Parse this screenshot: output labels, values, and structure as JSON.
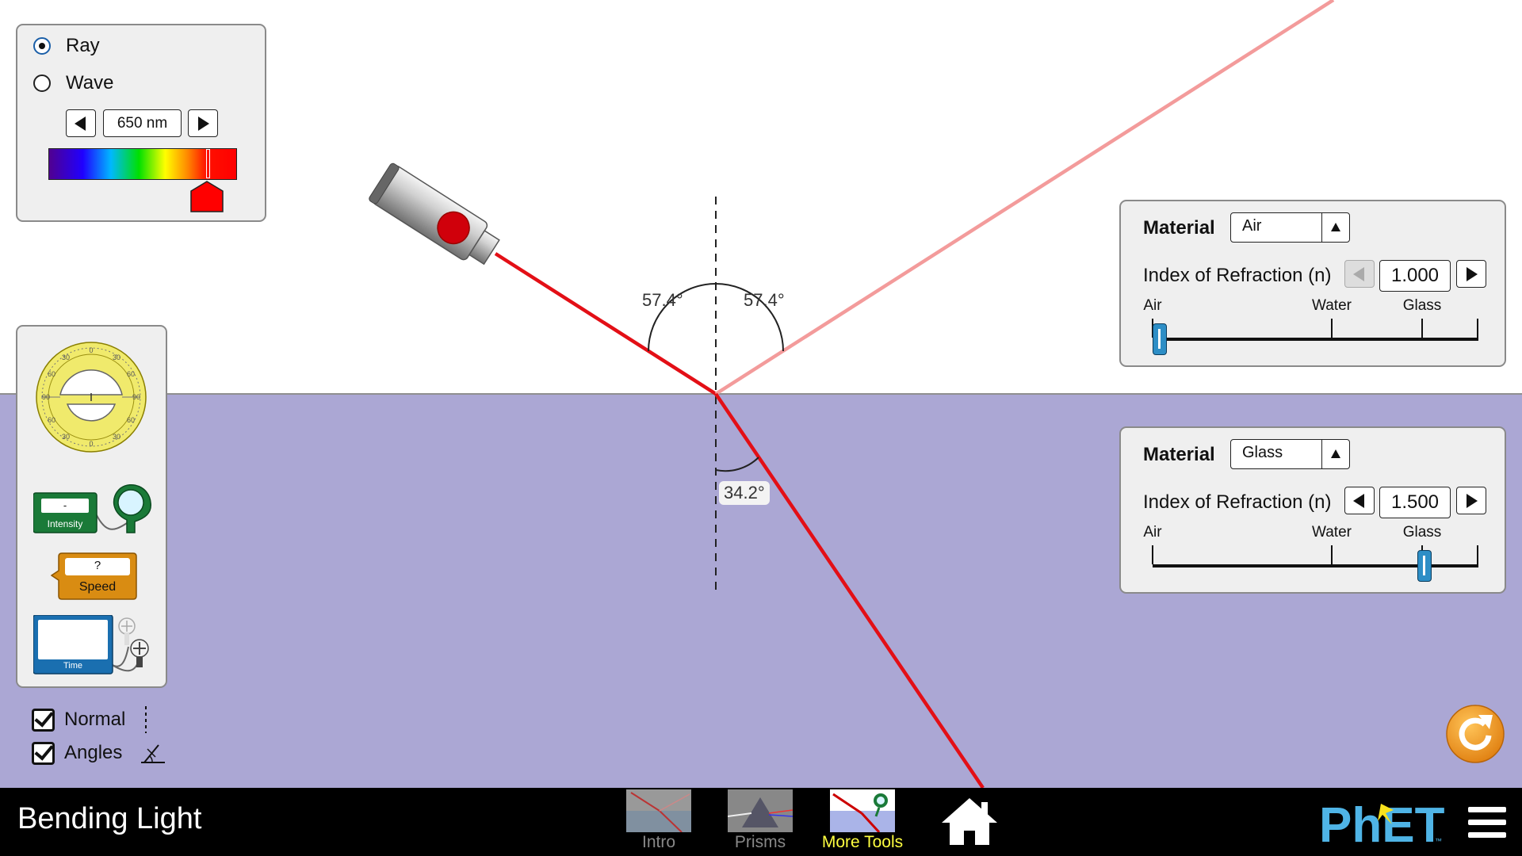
{
  "app": {
    "title": "Bending Light"
  },
  "light_panel": {
    "options": [
      "Ray",
      "Wave"
    ],
    "selected": "Ray",
    "wavelength_value": "650 nm",
    "wavelength_fraction": 0.84
  },
  "angles": {
    "incident": "57.4°",
    "reflected": "57.4°",
    "refracted": "34.2°"
  },
  "top_medium": {
    "material_label": "Material",
    "material_value": "Air",
    "ior_label": "Index of Refraction (n)",
    "ior_value": "1.000",
    "slider_ticks": [
      "Air",
      "Water",
      "Glass"
    ],
    "slider_fraction": 0.0
  },
  "bottom_medium": {
    "material_label": "Material",
    "material_value": "Glass",
    "ior_label": "Index of Refraction (n)",
    "ior_value": "1.500",
    "slider_ticks": [
      "Air",
      "Water",
      "Glass"
    ],
    "slider_fraction": 0.835
  },
  "toolbox": {
    "protractor_numbers": [
      "0",
      "30",
      "60",
      "90",
      "60",
      "30",
      "0",
      "30",
      "60",
      "90",
      "60",
      "30"
    ],
    "intensity_label": "Intensity",
    "intensity_value": "-",
    "speed_label": "Speed",
    "speed_value": "?",
    "time_label": "Time"
  },
  "checkboxes": {
    "normal_label": "Normal",
    "angles_label": "Angles",
    "normal_checked": true,
    "angles_checked": true
  },
  "nav": {
    "screens": [
      "Intro",
      "Prisms",
      "More Tools"
    ],
    "active": "More Tools",
    "brand": "PhET"
  },
  "colors": {
    "medium_glass": "#aba7d4",
    "ray": "#e30f16",
    "reflected_ray": "#f39b9b",
    "slider_thumb": "#2d8ec6",
    "active_screen": "#ffff40",
    "reset": "#f29a1c",
    "phet_blue": "#4fb4e6",
    "phet_yellow": "#f7e11c"
  }
}
